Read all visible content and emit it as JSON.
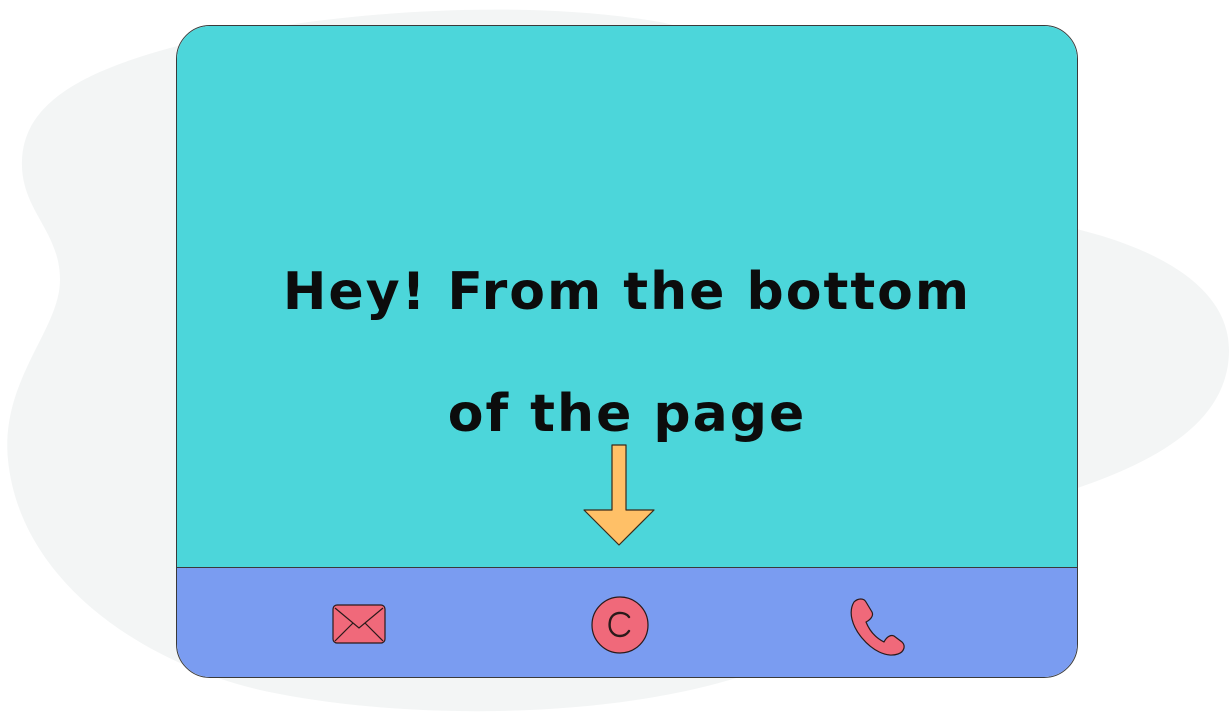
{
  "headline": {
    "line1": "Hey! From the bottom",
    "line2": "of the page"
  },
  "footer": {
    "icons": [
      "mail-icon",
      "copyright-icon",
      "phone-icon"
    ]
  },
  "colors": {
    "hero_bg": "#4cd6da",
    "footer_bg": "#7a9cf1",
    "icon_fill": "#f0697a",
    "arrow_fill": "#ffc067",
    "backdrop_blob": "#f3f5f5"
  }
}
